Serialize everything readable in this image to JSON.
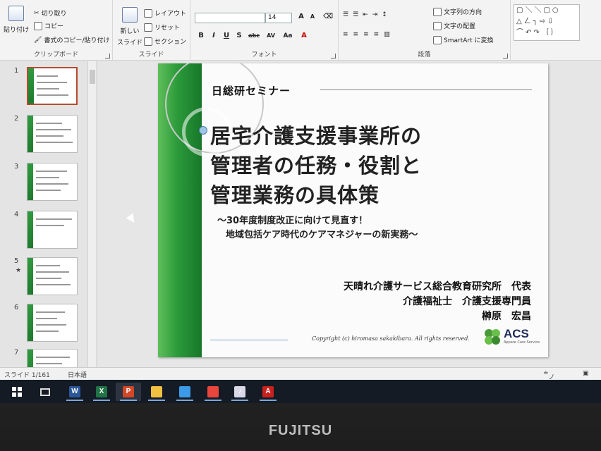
{
  "ribbon": {
    "clipboard": {
      "paste": "貼り付け",
      "cut": "切り取り",
      "copy": "コピー",
      "format_painter": "書式のコピー/貼り付け",
      "group_label": "クリップボード"
    },
    "slides": {
      "new_slide": "新しい",
      "new_slide_2": "スライド",
      "layout": "レイアウト",
      "reset": "リセット",
      "section": "セクション",
      "group_label": "スライド"
    },
    "font": {
      "font_name": "",
      "font_size": "14",
      "bold": "B",
      "italic": "I",
      "underline": "U",
      "shadow": "S",
      "strike": "abc",
      "spacing": "AV",
      "case": "Aa",
      "group_label": "フォント"
    },
    "paragraph": {
      "text_direction": "文字列の方向",
      "align_text": "文字の配置",
      "smartart": "SmartArt に変換",
      "group_label": "段落"
    }
  },
  "thumbnails": [
    {
      "num": "1",
      "star": ""
    },
    {
      "num": "2",
      "star": ""
    },
    {
      "num": "3",
      "star": ""
    },
    {
      "num": "4",
      "star": ""
    },
    {
      "num": "5",
      "star": "★"
    },
    {
      "num": "6",
      "star": ""
    },
    {
      "num": "7",
      "star": ""
    }
  ],
  "slide": {
    "seminar": "日総研セミナー",
    "title_1": "居宅介護支援事業所の",
    "title_2": "管理者の任務・役割と",
    "title_3": "管理業務の具体策",
    "subtitle_1": "～30年度制度改正に向けて見直す！",
    "subtitle_2": "地域包括ケア時代のケアマネジャーの新実務～",
    "presenter_1": "天晴れ介護サービス総合教育研究所　代表",
    "presenter_2": "介護福祉士　介護支援専門員",
    "presenter_3": "榊原　宏昌",
    "copyright": "Copyright (c)  hiromasa sakakibara. All rights reserved.",
    "logo_text": "ACS",
    "logo_sub": "Appare Care Service"
  },
  "statusbar": {
    "slide_counter": "スライド 1/161",
    "language": "日本語",
    "notes": "ノート"
  },
  "taskbar": {
    "apps": [
      {
        "name": "word",
        "label": "W",
        "color": "#2b579a"
      },
      {
        "name": "excel",
        "label": "X",
        "color": "#217346"
      },
      {
        "name": "powerpoint",
        "label": "P",
        "color": "#d24726"
      },
      {
        "name": "explorer",
        "label": "",
        "color": "#f0c040"
      },
      {
        "name": "dropbox",
        "label": "",
        "color": "#3d9ae8"
      },
      {
        "name": "chrome",
        "label": "",
        "color": "#e8453c"
      },
      {
        "name": "itunes",
        "label": "♪",
        "color": "#d8d8e8"
      },
      {
        "name": "acrobat",
        "label": "A",
        "color": "#c9211e"
      }
    ]
  },
  "bezel": {
    "brand": "FUJITSU"
  }
}
